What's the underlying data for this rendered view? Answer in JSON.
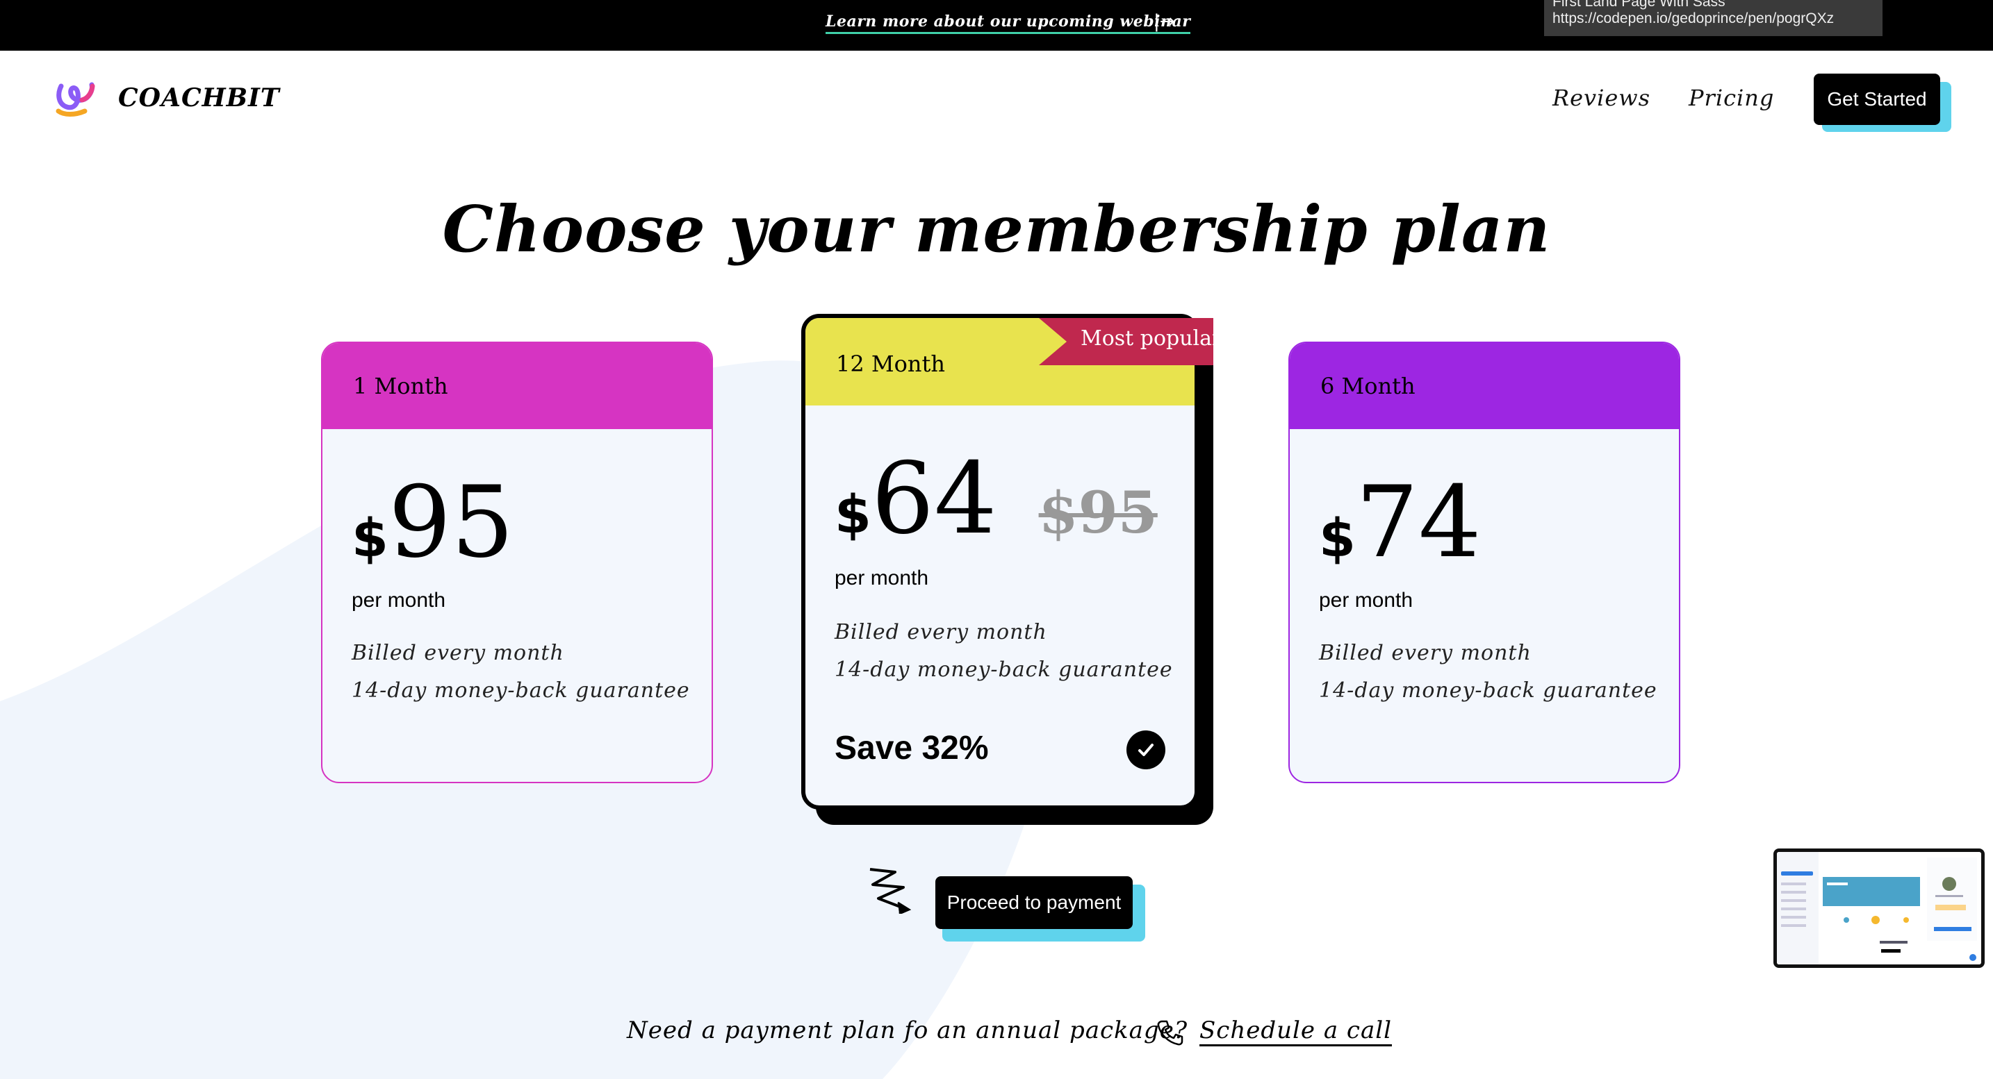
{
  "banner": {
    "link_text": "Learn more about our upcoming webinar",
    "arrow": "|→",
    "tooltip_line1": "First Land Page With Sass",
    "tooltip_line2": "https://codepen.io/gedoprince/pen/pogrQXz"
  },
  "header": {
    "brand": "COACHBIT",
    "nav": [
      "Reviews",
      "Pricing"
    ],
    "cta_label": "Get Started"
  },
  "heading": "Choose your membership plan",
  "plans": [
    {
      "name": "1 Month",
      "currency": "$",
      "price": "95",
      "period": "per month",
      "billing": "Billed every month",
      "guarantee": "14-day money-back guarantee",
      "header_color": "#d634c2"
    },
    {
      "name": "12 Month",
      "currency": "$",
      "price": "64",
      "old_price": "$95",
      "period": "per month",
      "billing": "Billed every month",
      "guarantee": "14-day money-back guarantee",
      "save_label": "Save 32%",
      "badge": "Most popular",
      "header_color": "#e8e34e",
      "badge_color": "#c0284e",
      "selected": true
    },
    {
      "name": "6 Month",
      "currency": "$",
      "price": "74",
      "period": "per month",
      "billing": "Billed every month",
      "guarantee": "14-day money-back guarantee",
      "header_color": "#9d26e2"
    }
  ],
  "proceed_label": "Proceed to payment",
  "footer": {
    "note": "Need a payment plan fo an annual package?",
    "link": "Schedule a call"
  },
  "colors": {
    "accent_shadow": "#5fd3ec",
    "banner_underline": "#3fd0a8",
    "background_shape": "#f0f5fc"
  },
  "icons": [
    "logo-icon",
    "arrow-right-icon",
    "check-icon",
    "squiggle-arrow-icon",
    "phone-icon"
  ]
}
